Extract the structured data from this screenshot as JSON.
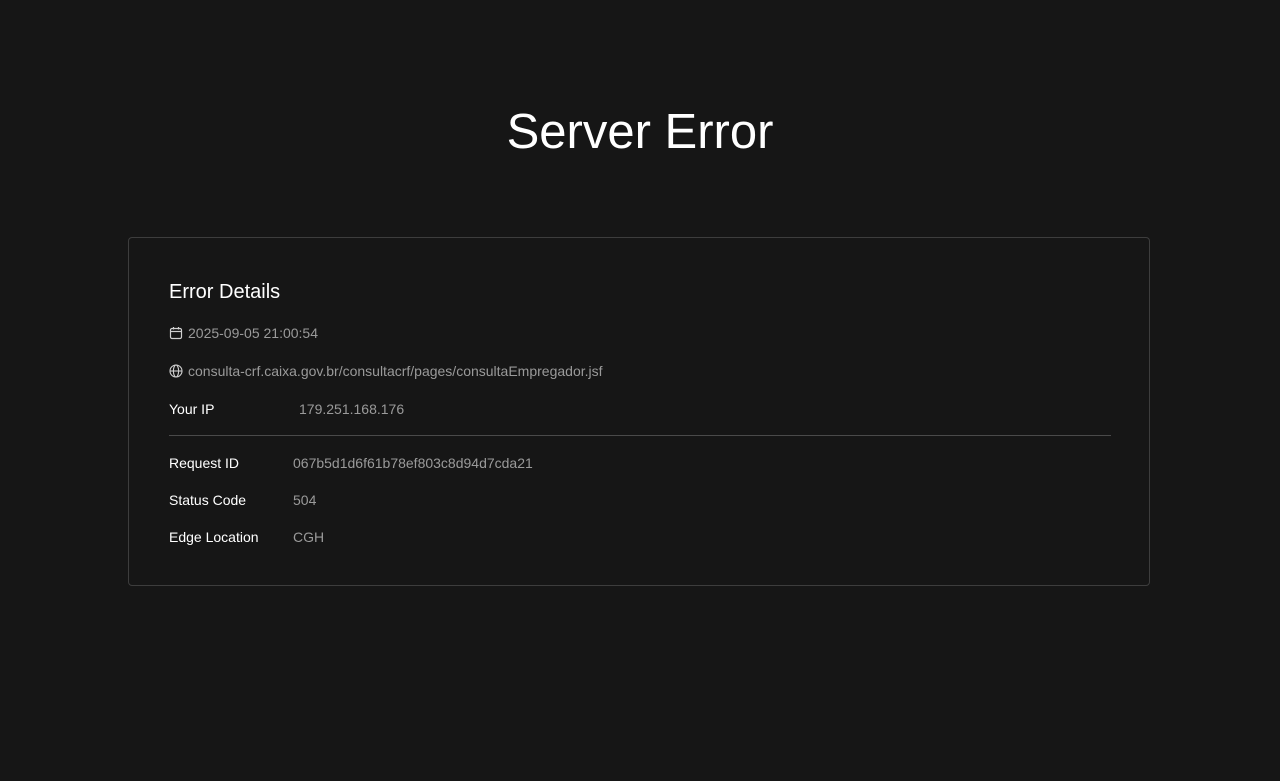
{
  "page": {
    "title": "Server Error"
  },
  "details": {
    "heading": "Error Details",
    "timestamp": "2025-09-05 21:00:54",
    "timestamp_icon": "calendar-icon",
    "url": "consulta-crf.caixa.gov.br/consultacrf/pages/consultaEmpregador.jsf",
    "url_icon": "globe-icon",
    "your_ip_label": "Your IP",
    "your_ip_value": "179.251.168.176",
    "request_id_label": "Request ID",
    "request_id_value": "067b5d1d6f61b78ef803c8d94d7cda21",
    "status_code_label": "Status Code",
    "status_code_value": "504",
    "edge_location_label": "Edge Location",
    "edge_location_value": "CGH"
  },
  "colors": {
    "background": "#161616",
    "text_primary": "#ffffff",
    "text_secondary": "#9a9a9a",
    "border": "#3d3d3d"
  }
}
